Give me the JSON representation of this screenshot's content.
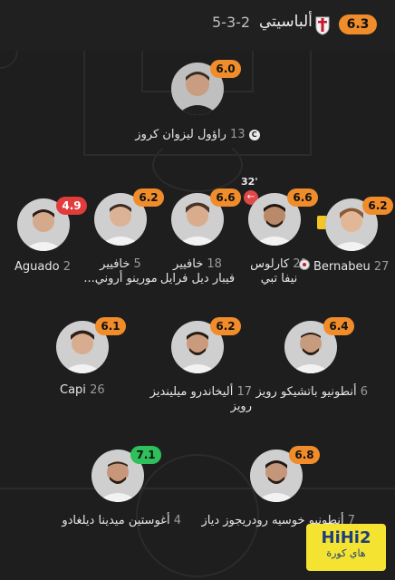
{
  "header": {
    "rating": "6.3",
    "team_name": "ألباسيتي",
    "formation": "5-3-2",
    "logo_icon": "albacete-crest-icon"
  },
  "players": [
    {
      "id": "gk",
      "number": "13",
      "name": "راؤول ليزوان كروز",
      "rating": "6.0",
      "rating_color": "orange",
      "captain": true
    },
    {
      "id": "p2",
      "number": "2",
      "name": "Aguado",
      "rating": "4.9",
      "rating_color": "red"
    },
    {
      "id": "p5",
      "number": "5",
      "name": "خافيير",
      "name2": "مورينو أروني...",
      "rating": "6.2",
      "rating_color": "orange"
    },
    {
      "id": "p18",
      "number": "18",
      "name": "خافيير",
      "name2": "فيبار ديل فرايل",
      "rating": "6.6",
      "rating_color": "orange"
    },
    {
      "id": "p21",
      "number": "21",
      "name": "كارلوس",
      "name2": "نيفا تبي",
      "rating": "6.6",
      "rating_color": "orange",
      "sub_minute": "32'",
      "own_goal": true
    },
    {
      "id": "p27",
      "number": "27",
      "name": "Bernabeu",
      "rating": "6.2",
      "rating_color": "orange",
      "yellow_card": true
    },
    {
      "id": "p26",
      "number": "26",
      "name": "Capi",
      "rating": "6.1",
      "rating_color": "orange"
    },
    {
      "id": "p17",
      "number": "17",
      "name": "أليخاندرو ميلينديز",
      "name2": "رويز",
      "rating": "6.2",
      "rating_color": "orange"
    },
    {
      "id": "p6",
      "number": "6",
      "name": "أنطونيو باتشيكو رويز",
      "rating": "6.4",
      "rating_color": "orange"
    },
    {
      "id": "p4",
      "number": "4",
      "name": "أغوستين ميدينا ديلغادو",
      "rating": "7.1",
      "rating_color": "green"
    },
    {
      "id": "p7",
      "number": "7",
      "name": "أنطونيو خوسيه رودريجوز دياز",
      "rating": "6.8",
      "rating_color": "orange"
    }
  ],
  "watermark": {
    "logo": "HiHi2",
    "sub": "هاي كورة"
  }
}
